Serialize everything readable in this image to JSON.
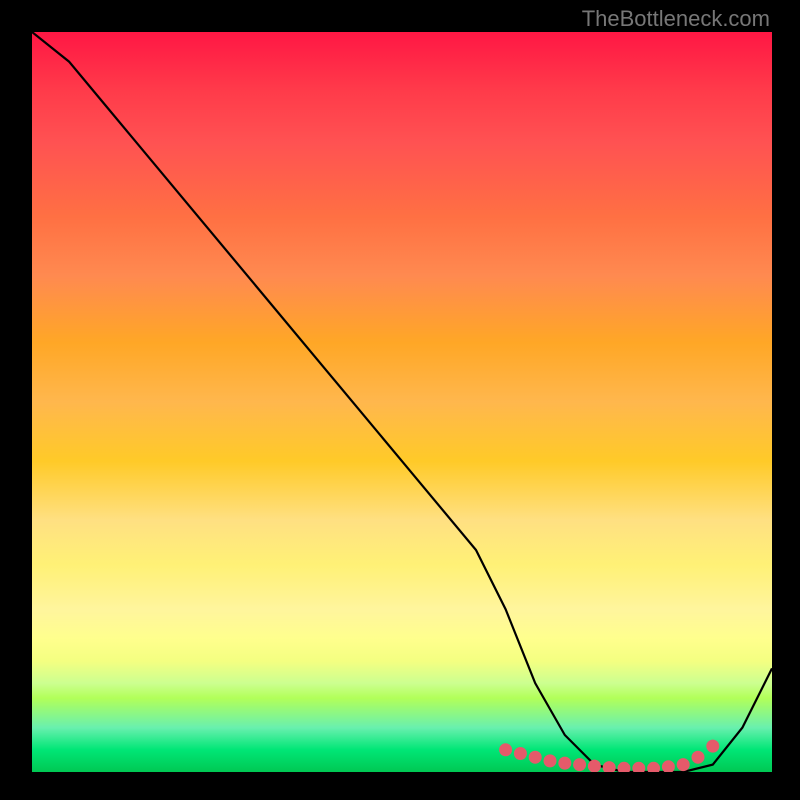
{
  "watermark": "TheBottleneck.com",
  "chart_data": {
    "type": "line",
    "title": "",
    "xlabel": "",
    "ylabel": "",
    "xlim": [
      0,
      100
    ],
    "ylim": [
      0,
      100
    ],
    "series": [
      {
        "name": "bottleneck-curve",
        "x": [
          0,
          5,
          10,
          20,
          30,
          40,
          50,
          60,
          64,
          68,
          72,
          76,
          80,
          84,
          88,
          92,
          96,
          100
        ],
        "y": [
          100,
          96,
          90,
          78,
          66,
          54,
          42,
          30,
          22,
          12,
          5,
          1,
          0,
          0,
          0,
          1,
          6,
          14
        ]
      }
    ],
    "markers": {
      "name": "highlight-range",
      "color": "#e55a6a",
      "x": [
        64,
        66,
        68,
        70,
        72,
        74,
        76,
        78,
        80,
        82,
        84,
        86,
        88,
        90,
        92
      ],
      "y": [
        3.0,
        2.5,
        2.0,
        1.5,
        1.2,
        1.0,
        0.8,
        0.6,
        0.5,
        0.5,
        0.5,
        0.7,
        1.0,
        2.0,
        3.5
      ]
    },
    "colors": {
      "curve": "#000000",
      "marker": "#e55a6a",
      "gradient_top": "#ff1744",
      "gradient_mid": "#fff176",
      "gradient_bottom": "#00c853"
    }
  }
}
